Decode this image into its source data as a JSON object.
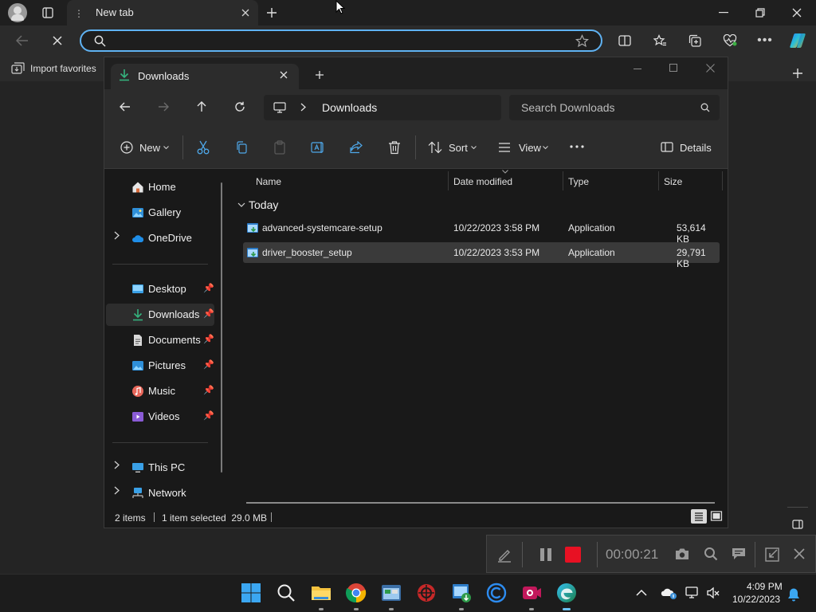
{
  "browser": {
    "tab_title": "New tab",
    "favorites_label": "Import favorites",
    "address_value": ""
  },
  "explorer": {
    "tab_title": "Downloads",
    "breadcrumb": "Downloads",
    "search_placeholder": "Search Downloads",
    "commands": {
      "new_label": "New",
      "sort_label": "Sort",
      "view_label": "View",
      "details_label": "Details"
    },
    "sidebar": {
      "items": [
        {
          "label": "Home",
          "icon": "home-icon",
          "pinned": false,
          "expandable": false
        },
        {
          "label": "Gallery",
          "icon": "gallery-icon",
          "pinned": false,
          "expandable": false
        },
        {
          "label": "OneDrive",
          "icon": "onedrive-icon",
          "pinned": false,
          "expandable": true
        },
        {
          "label": "Desktop",
          "icon": "desktop-icon",
          "pinned": true,
          "expandable": false
        },
        {
          "label": "Downloads",
          "icon": "downloads-icon",
          "pinned": true,
          "expandable": false,
          "selected": true
        },
        {
          "label": "Documents",
          "icon": "documents-icon",
          "pinned": true,
          "expandable": false
        },
        {
          "label": "Pictures",
          "icon": "pictures-icon",
          "pinned": true,
          "expandable": false
        },
        {
          "label": "Music",
          "icon": "music-icon",
          "pinned": true,
          "expandable": false
        },
        {
          "label": "Videos",
          "icon": "videos-icon",
          "pinned": true,
          "expandable": false
        },
        {
          "label": "This PC",
          "icon": "this-pc-icon",
          "pinned": false,
          "expandable": true
        },
        {
          "label": "Network",
          "icon": "network-icon",
          "pinned": false,
          "expandable": true
        }
      ]
    },
    "columns": [
      "Name",
      "Date modified",
      "Type",
      "Size"
    ],
    "group_label": "Today",
    "files": [
      {
        "name": "advanced-systemcare-setup",
        "date": "10/22/2023 3:58 PM",
        "type": "Application",
        "size": "53,614 KB",
        "selected": false
      },
      {
        "name": "driver_booster_setup",
        "date": "10/22/2023 3:53 PM",
        "type": "Application",
        "size": "29,791 KB",
        "selected": true
      }
    ],
    "status": {
      "count": "2 items",
      "selection": "1 item selected  29.0 MB"
    }
  },
  "recorder": {
    "timer": "00:00:21"
  },
  "taskbar": {
    "time": "4:09 PM",
    "date": "10/22/2023"
  },
  "colors": {
    "accent": "#5fb2f2",
    "record_red": "#e81123"
  }
}
